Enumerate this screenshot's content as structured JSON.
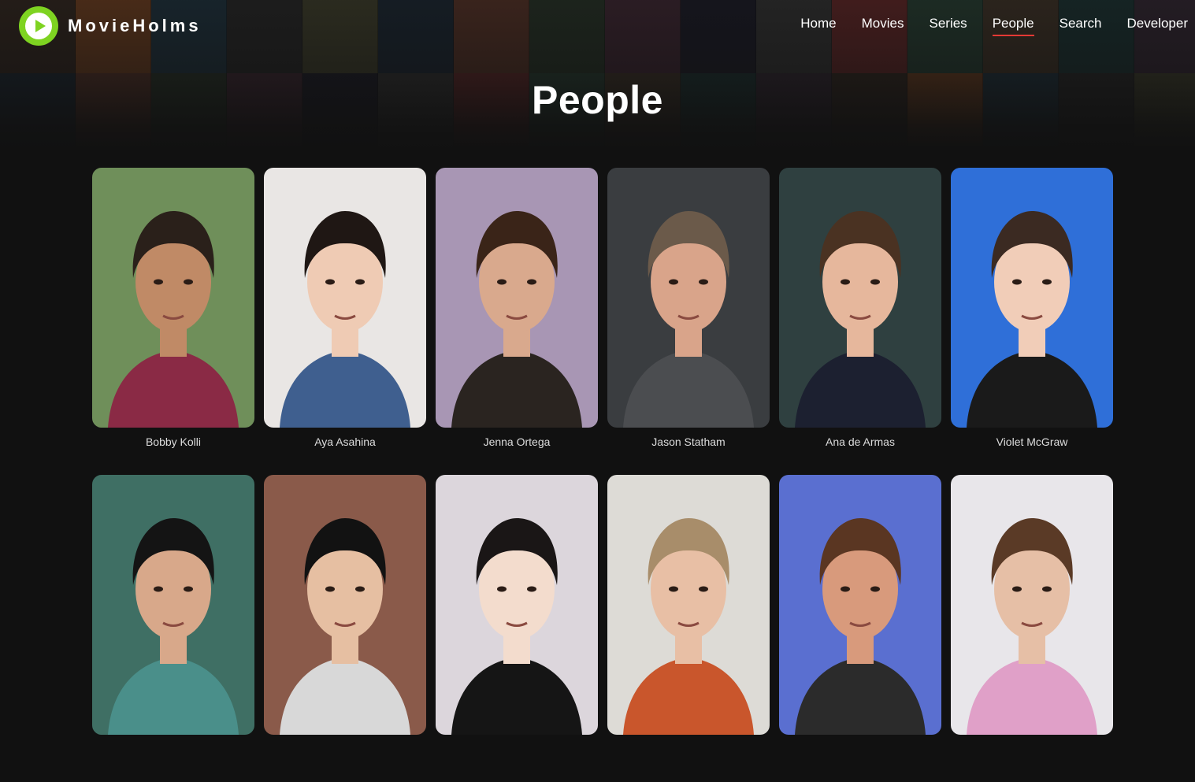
{
  "brand": {
    "name": "MovieHolms",
    "accent": "#7ed321"
  },
  "nav": {
    "items": [
      {
        "label": "Home",
        "active": false
      },
      {
        "label": "Movies",
        "active": false
      },
      {
        "label": "Series",
        "active": false
      },
      {
        "label": "People",
        "active": true
      },
      {
        "label": "Search",
        "active": false
      },
      {
        "label": "Developer",
        "active": false
      }
    ],
    "active_color": "#e53935"
  },
  "page": {
    "title": "People"
  },
  "people": [
    {
      "name": "Bobby Kolli",
      "bg": "#6f8f5a",
      "skin": "#c08a66",
      "hair": "#2a201a",
      "shirt": "#8a2a45"
    },
    {
      "name": "Aya Asahina",
      "bg": "#e9e6e4",
      "skin": "#efcbb4",
      "hair": "#1f1714",
      "shirt": "#3f5f8f"
    },
    {
      "name": "Jenna Ortega",
      "bg": "#a896b4",
      "skin": "#d9a98d",
      "hair": "#3a2418",
      "shirt": "#2a2420"
    },
    {
      "name": "Jason Statham",
      "bg": "#3a3d40",
      "skin": "#d9a48a",
      "hair": "#6b5a4a",
      "shirt": "#4b4d50"
    },
    {
      "name": "Ana de Armas",
      "bg": "#2f4040",
      "skin": "#e6b79c",
      "hair": "#4a3222",
      "shirt": "#1c2030"
    },
    {
      "name": "Violet McGraw",
      "bg": "#2f6fd8",
      "skin": "#f1cdb8",
      "hair": "#3b2a22",
      "shirt": "#1a1a1a"
    },
    {
      "name": "",
      "bg": "#3f6f64",
      "skin": "#d8a88a",
      "hair": "#141414",
      "shirt": "#4a8f8a"
    },
    {
      "name": "",
      "bg": "#8a5a4a",
      "skin": "#e6bfa2",
      "hair": "#121212",
      "shirt": "#d8d8d8"
    },
    {
      "name": "",
      "bg": "#dcd6dc",
      "skin": "#f3dccd",
      "hair": "#1a1616",
      "shirt": "#151515"
    },
    {
      "name": "",
      "bg": "#dddbd6",
      "skin": "#e8bfa5",
      "hair": "#a88d6a",
      "shirt": "#c9562c"
    },
    {
      "name": "",
      "bg": "#5a6fd0",
      "skin": "#d89a7c",
      "hair": "#5a3622",
      "shirt": "#2b2b2b"
    },
    {
      "name": "",
      "bg": "#e8e6ea",
      "skin": "#e6bfa6",
      "hair": "#5a3a26",
      "shirt": "#e0a0c8"
    }
  ],
  "poster_colors": [
    "#3a2a20",
    "#8a4a20",
    "#1f3a4a",
    "#2a2a2a",
    "#4a4a30",
    "#1a2a3a",
    "#6a3a2a",
    "#2a3a2a",
    "#4a2a3a",
    "#1a1a2a",
    "#3a3a3a",
    "#7a2a2a",
    "#2a4a3a",
    "#4a3a2a",
    "#1a3a3a",
    "#3a2a3a"
  ]
}
